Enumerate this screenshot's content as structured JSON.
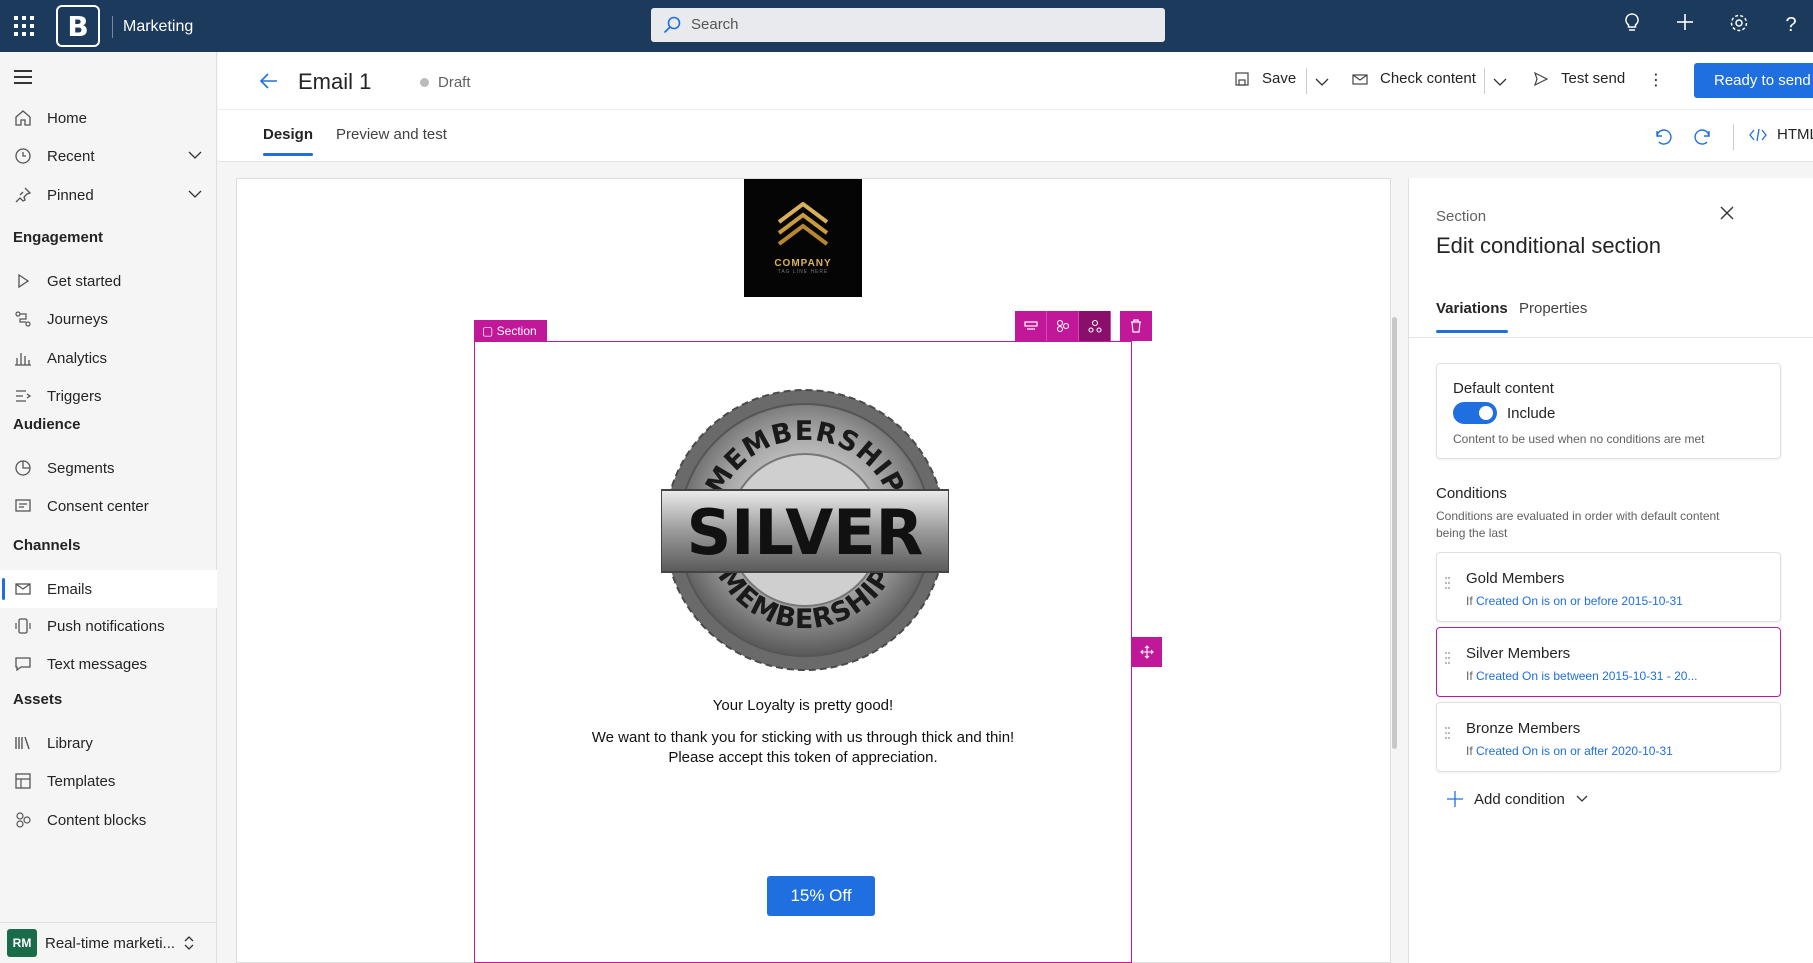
{
  "topbar": {
    "app_name": "Marketing",
    "search_placeholder": "Search"
  },
  "sidebar": {
    "items": [
      {
        "label": "Home"
      },
      {
        "label": "Recent"
      },
      {
        "label": "Pinned"
      }
    ],
    "groups": {
      "engagement": "Engagement",
      "audience": "Audience",
      "channels": "Channels",
      "assets": "Assets"
    },
    "engagement_items": [
      {
        "label": "Get started"
      },
      {
        "label": "Journeys"
      },
      {
        "label": "Analytics"
      },
      {
        "label": "Triggers"
      }
    ],
    "audience_items": [
      {
        "label": "Segments"
      },
      {
        "label": "Consent center"
      }
    ],
    "channels_items": [
      {
        "label": "Emails"
      },
      {
        "label": "Push notifications"
      },
      {
        "label": "Text messages"
      }
    ],
    "assets_items": [
      {
        "label": "Library"
      },
      {
        "label": "Templates"
      },
      {
        "label": "Content blocks"
      }
    ],
    "environment": {
      "badge": "RM",
      "label": "Real-time marketi..."
    }
  },
  "header": {
    "title": "Email 1",
    "status": "Draft",
    "save_label": "Save",
    "check_content_label": "Check content",
    "test_send_label": "Test send",
    "ready_label": "Ready to send",
    "html_label": "HTML"
  },
  "tabs": {
    "design": "Design",
    "preview": "Preview and test"
  },
  "email": {
    "logo_company": "COMPANY",
    "logo_tagline": "TAG LINE HERE",
    "section_label": "Section",
    "seal_top": "MEMBERSHIP",
    "seal_main": "SILVER",
    "seal_bottom": "MEMBERSHIP",
    "line1": "Your Loyalty is pretty good!",
    "line2a": "We want to thank you for sticking with us through thick and thin!",
    "line2b": "Please accept this token of appreciation.",
    "cta": "15% Off"
  },
  "panel": {
    "kicker": "Section",
    "title": "Edit conditional section",
    "tab_variations": "Variations",
    "tab_properties": "Properties",
    "default_title": "Default content",
    "default_toggle": "Include",
    "default_desc": "Content to be used when no conditions are met",
    "conditions_title": "Conditions",
    "conditions_desc1": "Conditions are evaluated in order with default content",
    "conditions_desc2": "being the last",
    "conditions": [
      {
        "name": "Gold Members",
        "if": "If",
        "rule": "Created On is on or before 2015-10-31"
      },
      {
        "name": "Silver Members",
        "if": "If",
        "rule": "Created On is between 2015-10-31 - 20..."
      },
      {
        "name": "Bronze Members",
        "if": "If",
        "rule": "Created On is on or after 2020-10-31"
      }
    ],
    "add_condition": "Add condition"
  }
}
